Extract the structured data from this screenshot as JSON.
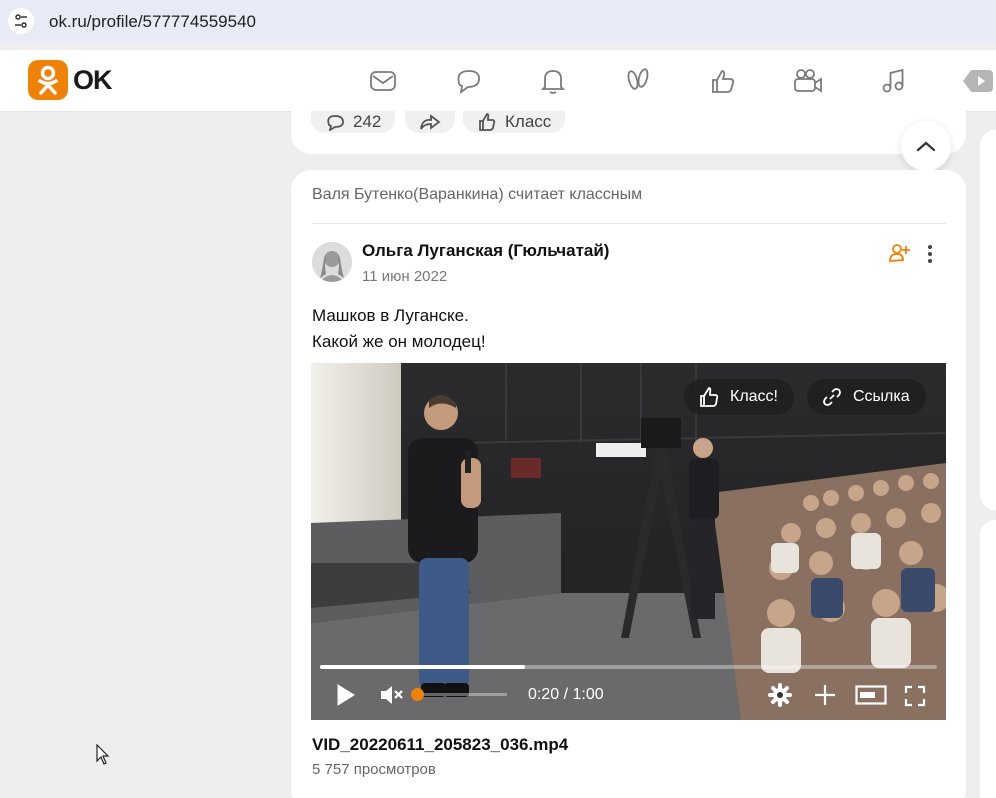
{
  "browser": {
    "url": "ok.ru/profile/577774559540"
  },
  "header": {
    "logo_text": "OK",
    "brand_color": "#ee8208",
    "nav_icons": [
      "mail-icon",
      "chat-icon",
      "bell-icon",
      "guests-icon",
      "like-icon",
      "video-camera-icon",
      "music-icon",
      "video-icon"
    ]
  },
  "prev_post": {
    "comments_count": "242",
    "class_label": "Класс"
  },
  "post": {
    "liked_by": "Валя Бутенко(Варанкина) считает классным",
    "author": "Ольга Луганская (Гюльчатай)",
    "date": "11 июн 2022",
    "text_line1": "Машков в Луганске.",
    "text_line2": "Какой же он молодец!",
    "video": {
      "class_button": "Класс!",
      "link_button": "Ссылка",
      "timecode": "0:20 / 1:00",
      "progress": 0.333,
      "volume_muted": true
    },
    "filename": "VID_20220611_205823_036.mp4",
    "views": "5 757 просмотров"
  }
}
